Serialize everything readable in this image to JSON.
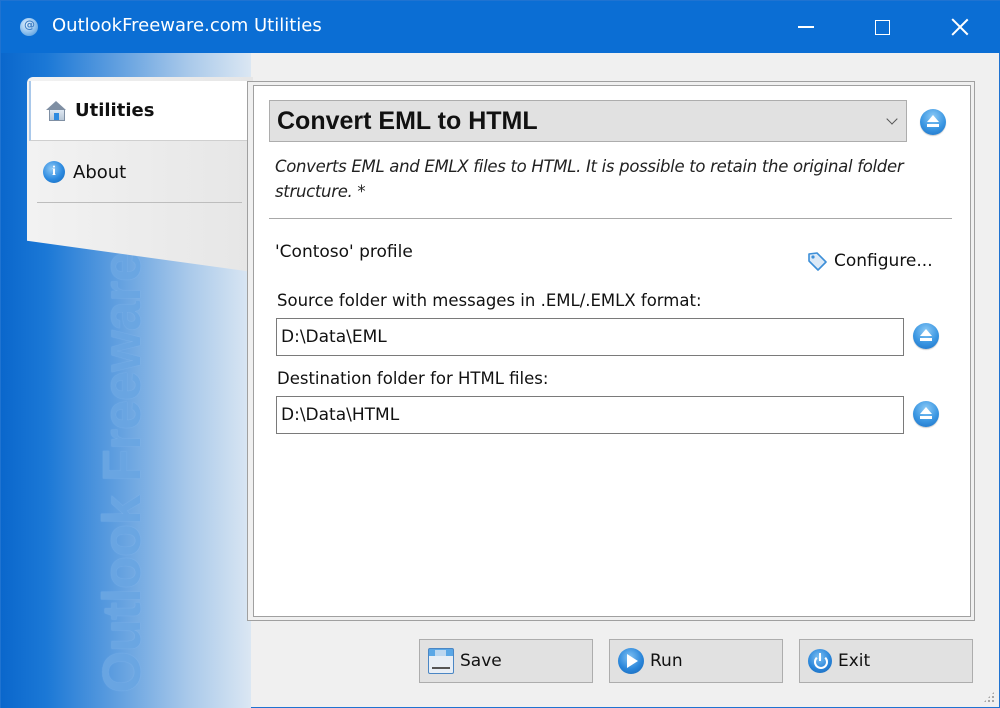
{
  "window": {
    "title": "OutlookFreeware.com Utilities",
    "controls": {
      "minimize": "minimize-icon",
      "maximize": "maximize-icon",
      "close": "close-icon"
    }
  },
  "branding": {
    "vertical_text": "Outlook Freeware .com"
  },
  "tabs": [
    {
      "label": "Utilities",
      "icon": "home-icon",
      "selected": true
    },
    {
      "label": "About",
      "icon": "info-icon",
      "selected": false
    }
  ],
  "main": {
    "utility_select": {
      "selected": "Convert EML to HTML"
    },
    "description": "Converts EML and EMLX files to HTML. It is possible to retain the original folder structure. *",
    "profile_label": "'Contoso' profile",
    "configure_label": "Configure...",
    "fields": {
      "source": {
        "label": "Source folder with messages in .EML/.EMLX format:",
        "value": "D:\\Data\\EML"
      },
      "destination": {
        "label": "Destination folder for HTML files:",
        "value": "D:\\Data\\HTML"
      }
    }
  },
  "buttons": {
    "save": "Save",
    "run": "Run",
    "exit": "Exit"
  },
  "colors": {
    "titlebar": "#0b6ed4",
    "accent_icon": "#2a86da"
  }
}
